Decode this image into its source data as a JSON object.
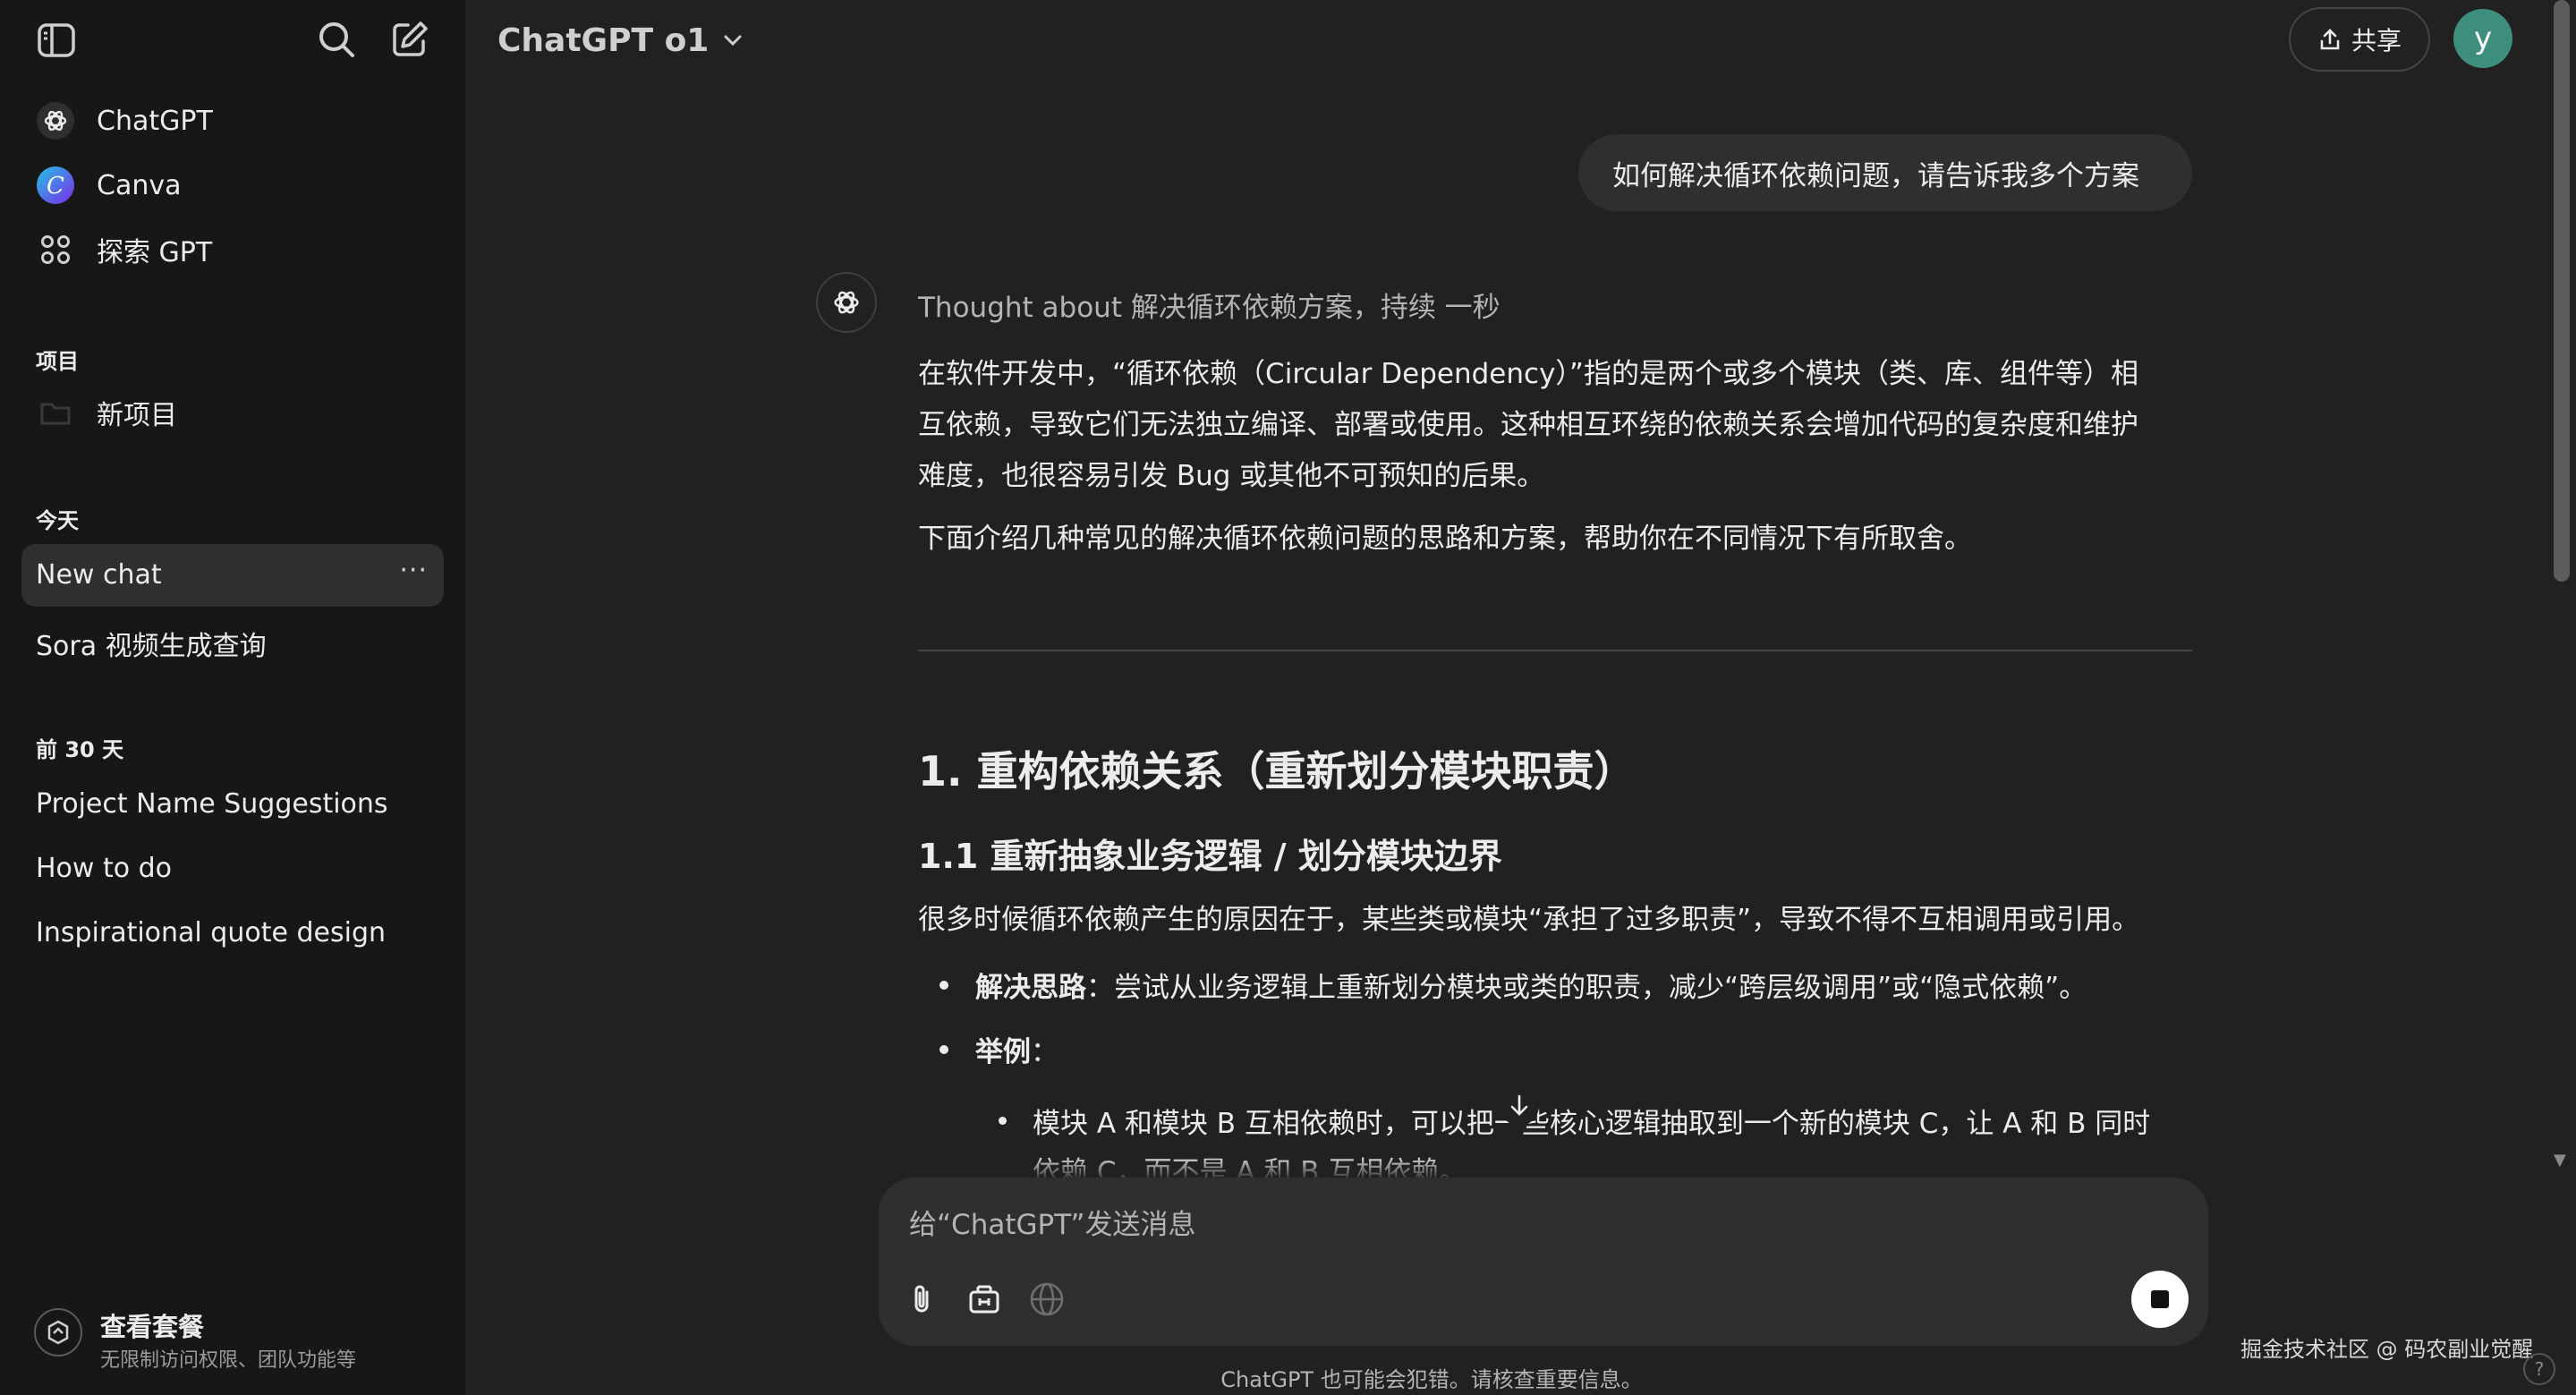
{
  "sidebar": {
    "top_items": [
      {
        "label": "ChatGPT",
        "icon": "chatgpt-logo-icon"
      },
      {
        "label": "Canva",
        "icon": "canva-logo-icon"
      },
      {
        "label": "探索 GPT",
        "icon": "grid-icon"
      }
    ],
    "projects": {
      "heading": "项目",
      "items": [
        {
          "label": "新项目",
          "icon": "folder-icon"
        }
      ]
    },
    "today": {
      "heading": "今天",
      "items": [
        {
          "label": "New chat",
          "active": true,
          "menu": "···"
        },
        {
          "label": "Sora 视频生成查询"
        }
      ]
    },
    "prev30": {
      "heading": "前 30 天",
      "items": [
        {
          "label": "Project Name Suggestions"
        },
        {
          "label": "How to do"
        },
        {
          "label": "Inspirational quote design"
        }
      ]
    },
    "plan": {
      "title": "查看套餐",
      "subtitle": "无限制访问权限、团队功能等"
    }
  },
  "header": {
    "model": "ChatGPT o1",
    "share_label": "共享",
    "avatar_letter": "y"
  },
  "chat": {
    "user_message": "如何解决循环依赖问题，请告诉我多个方案",
    "thought": "Thought about 解决循环依赖方案，持续 一秒",
    "intro_lines": [
      "在软件开发中，“循环依赖（Circular Dependency）”指的是两个或多个模块（类、库、组件等）相",
      "互依赖，导致它们无法独立编译、部署或使用。这种相互环绕的依赖关系会增加代码的复杂度和维护",
      "难度，也很容易引发 Bug 或其他不可预知的后果。"
    ],
    "intro2": "下面介绍几种常见的解决循环依赖问题的思路和方案，帮助你在不同情况下有所取舍。",
    "h1": "1. 重构依赖关系（重新划分模块职责）",
    "h2": "1.1 重新抽象业务逻辑 / 划分模块边界",
    "p3": "很多时候循环依赖产生的原因在于，某些类或模块“承担了过多职责”，导致不得不互相调用或引用。",
    "bullet1_bold": "解决思路",
    "bullet1_text": "：尝试从业务逻辑上重新划分模块或类的职责，减少“跨层级调用”或“隐式依赖”。",
    "bullet2_bold": "举例",
    "bullet2_text": "：",
    "sub_bullet_line1": "模块 A 和模块 B 互相依赖时，可以把一些核心逻辑抽取到一个新的模块 C，让 A 和 B 同时",
    "sub_bullet_line2": "依赖 C，而不是 A 和 B 互相依赖。"
  },
  "composer": {
    "placeholder": "给“ChatGPT”发送消息"
  },
  "footer": {
    "disclaimer": "ChatGPT 也可能会犯错。请核查重要信息。",
    "watermark": "掘金技术社区 @ 码农副业觉醒",
    "help": "?"
  }
}
